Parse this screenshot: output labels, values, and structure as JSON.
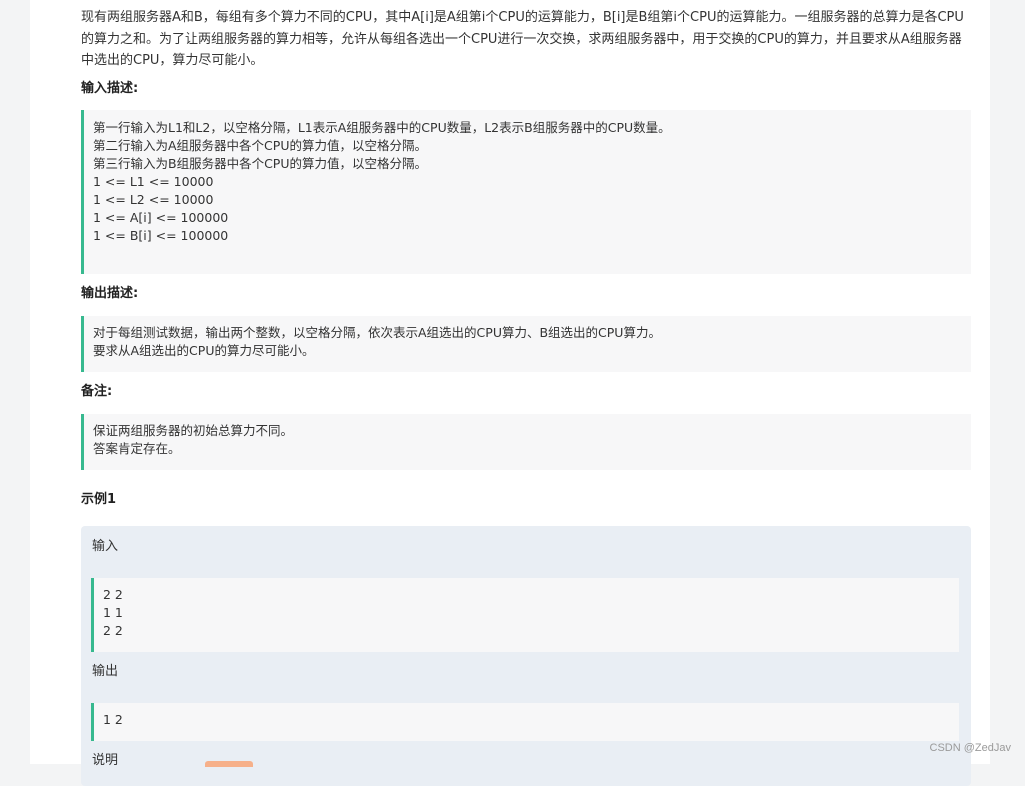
{
  "intro": "现有两组服务器A和B，每组有多个算力不同的CPU，其中A[i]是A组第i个CPU的运算能力，B[i]是B组第i个CPU的运算能力。一组服务器的总算力是各CPU的算力之和。为了让两组服务器的算力相等，允许从每组各选出一个CPU进行一次交换，求两组服务器中，用于交换的CPU的算力，并且要求从A组服务器中选出的CPU，算力尽可能小。",
  "input_section": {
    "title": "输入描述:",
    "lines": [
      "第一行输入为L1和L2，以空格分隔，L1表示A组服务器中的CPU数量，L2表示B组服务器中的CPU数量。",
      "第二行输入为A组服务器中各个CPU的算力值，以空格分隔。",
      "第三行输入为B组服务器中各个CPU的算力值，以空格分隔。",
      "1 <= L1 <= 10000",
      "1 <= L2 <= 10000",
      "1 <= A[i] <= 100000",
      "1 <= B[i] <= 100000"
    ]
  },
  "output_section": {
    "title": "输出描述:",
    "lines": [
      "对于每组测试数据，输出两个整数，以空格分隔，依次表示A组选出的CPU算力、B组选出的CPU算力。",
      "要求从A组选出的CPU的算力尽可能小。"
    ]
  },
  "note_section": {
    "title": "备注:",
    "lines": [
      "保证两组服务器的初始总算力不同。",
      "答案肯定存在。"
    ]
  },
  "example": {
    "title": "示例1",
    "input_label": "输入",
    "input_lines": [
      "2 2",
      "1 1",
      "2 2"
    ],
    "output_label": "输出",
    "output_lines": [
      "1 2"
    ],
    "explain_label": "说明"
  },
  "watermark": "CSDN @ZedJav",
  "colors": {
    "accent_border": "#37b98f",
    "quote_bg": "#f7f7f8",
    "example_bg": "#e9eef4"
  }
}
